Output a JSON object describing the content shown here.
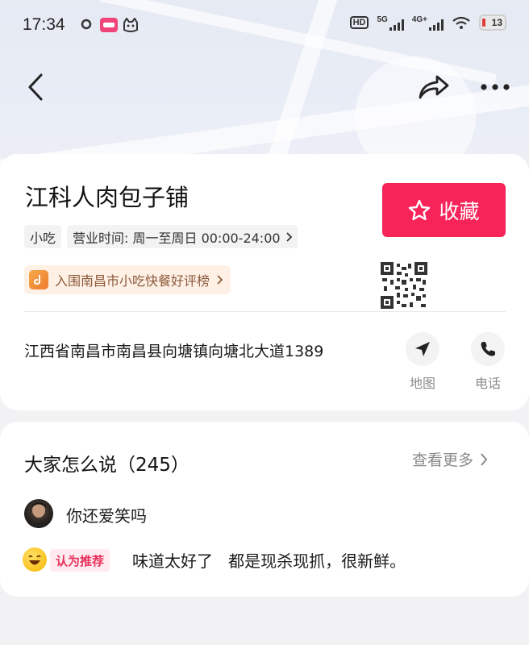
{
  "status_bar": {
    "time": "17:34",
    "hd_label": "HD",
    "net1": "5G",
    "net2": "4G+",
    "battery": "13"
  },
  "nav": {
    "back_icon": "chevron-left-icon",
    "share_icon": "share-icon",
    "more_icon": "more-dots-icon"
  },
  "shop": {
    "name": "江科人肉包子铺",
    "category": "小吃",
    "hours": "营业时间: 周一至周日 00:00-24:00",
    "rank": "入围南昌市小吃快餐好评榜",
    "favorite_label": "收藏",
    "address": "江西省南昌市南昌县向塘镇向塘北大道1389",
    "map_label": "地图",
    "phone_label": "电话"
  },
  "reviews": {
    "title": "大家怎么说（245）",
    "more_label": "查看更多",
    "items": [
      {
        "user": "你还爱笑吗",
        "badge": "认为推荐",
        "text": "味道太好了   都是现杀现抓，很新鲜。"
      }
    ]
  },
  "colors": {
    "accent": "#f7245a",
    "rank_bg": "#fff0e6",
    "badge_text": "#e8335e"
  }
}
